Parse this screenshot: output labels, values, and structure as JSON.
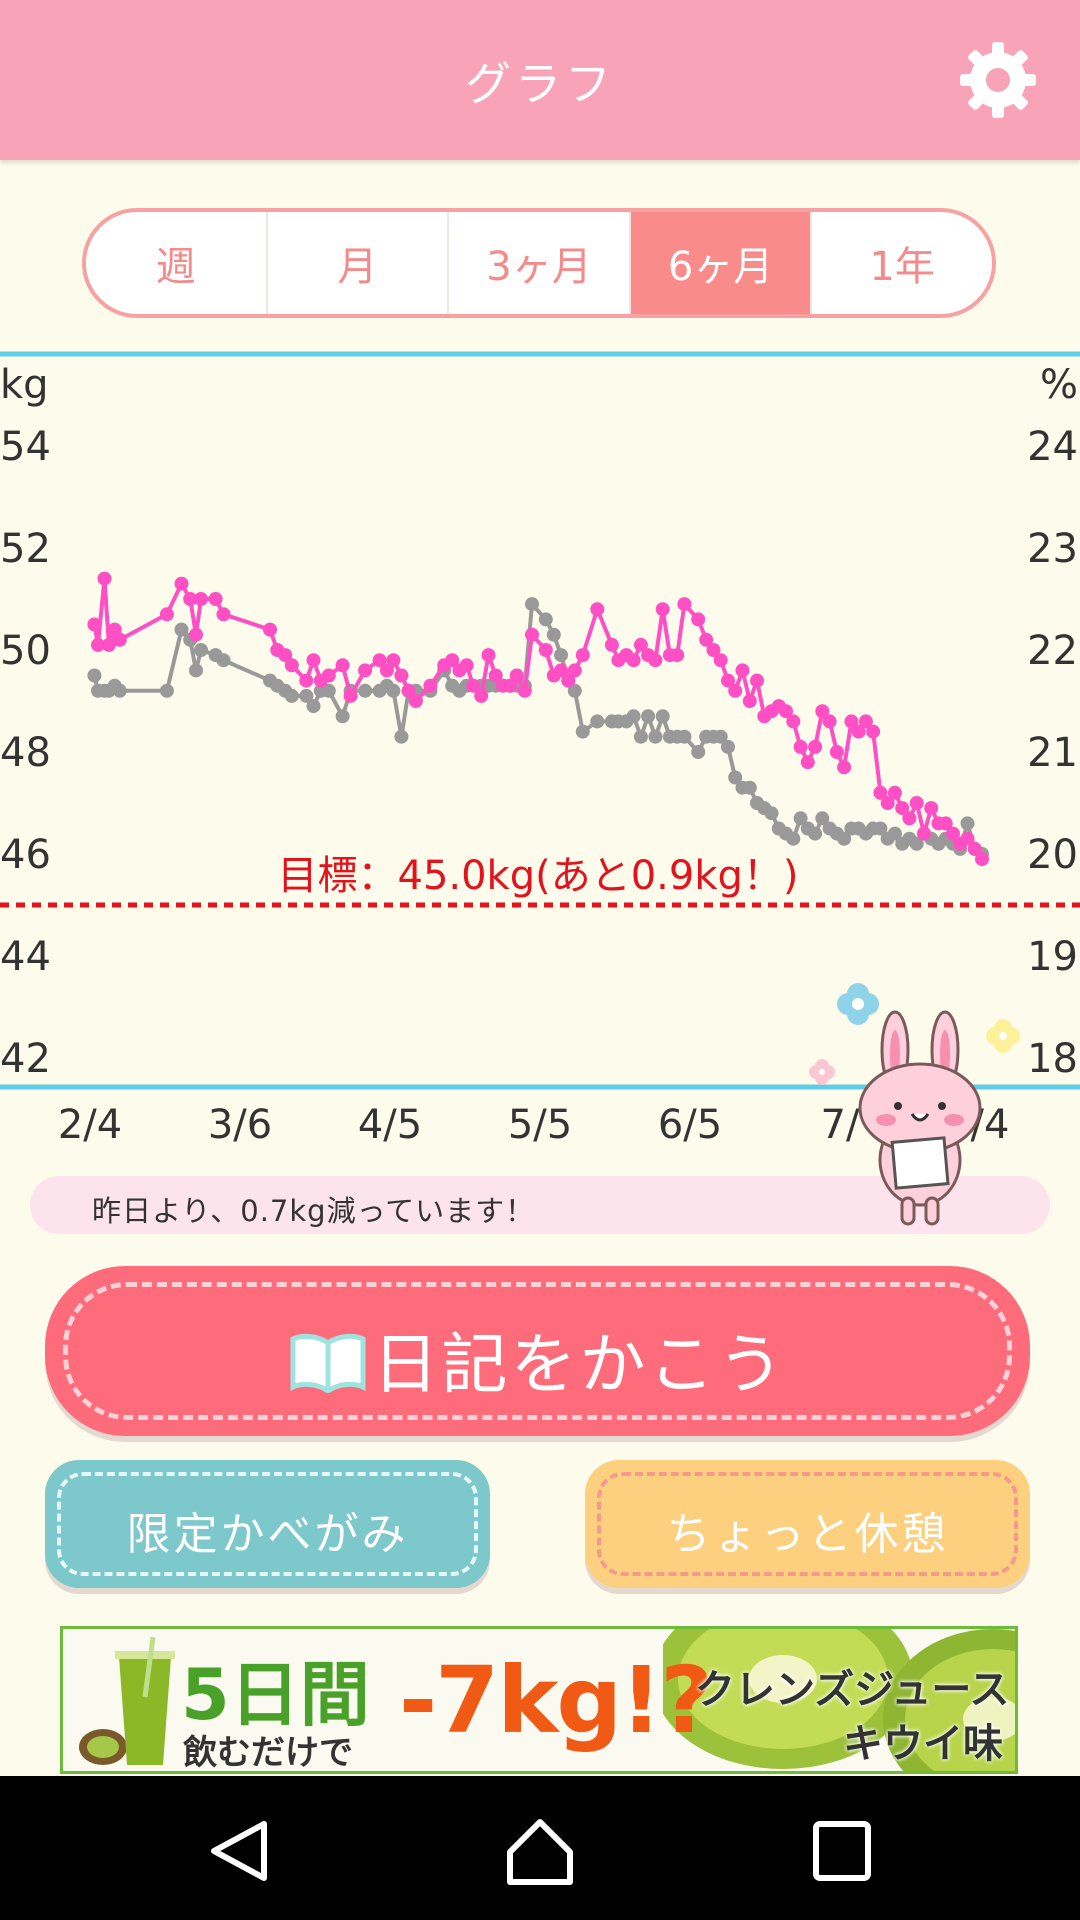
{
  "header": {
    "title": "グラフ",
    "settings_icon": "gear-icon"
  },
  "period_tabs": [
    {
      "label": "週",
      "active": false
    },
    {
      "label": "月",
      "active": false
    },
    {
      "label": "3ヶ月",
      "active": false
    },
    {
      "label": "6ヶ月",
      "active": true
    },
    {
      "label": "1年",
      "active": false
    }
  ],
  "chart_data": {
    "type": "line",
    "left_axis": {
      "unit": "kg",
      "ticks": [
        "54",
        "52",
        "50",
        "48",
        "46",
        "44",
        "42"
      ],
      "range": [
        42,
        54
      ]
    },
    "right_axis": {
      "unit": "%",
      "ticks": [
        "24",
        "23",
        "22",
        "21",
        "20",
        "19",
        "18"
      ],
      "range": [
        18,
        24
      ]
    },
    "x_ticks": [
      "2/4",
      "3/6",
      "4/5",
      "5/5",
      "6/5",
      "7/",
      "/4"
    ],
    "goal": {
      "value": 45.0,
      "label": "目標：45.0kg(あと0.9kg！)",
      "color": "#e1141e"
    },
    "series": [
      {
        "axis": "left",
        "color": "#ff4fc4",
        "points": [
          [
            0.6,
            50.5
          ],
          [
            1.1,
            50.1
          ],
          [
            2.0,
            51.4
          ],
          [
            2.6,
            50.1
          ],
          [
            3.4,
            50.4
          ],
          [
            4.1,
            50.2
          ],
          [
            10.6,
            50.7
          ],
          [
            12.6,
            51.3
          ],
          [
            13.8,
            51.0
          ],
          [
            14.6,
            50.3
          ],
          [
            15.3,
            51.0
          ],
          [
            17.3,
            51.0
          ],
          [
            18.4,
            50.7
          ],
          [
            24.8,
            50.4
          ],
          [
            25.8,
            50.0
          ],
          [
            26.9,
            49.9
          ],
          [
            27.8,
            49.7
          ],
          [
            29.8,
            49.4
          ],
          [
            30.8,
            49.8
          ],
          [
            31.8,
            49.4
          ],
          [
            32.9,
            49.5
          ],
          [
            34.8,
            49.7
          ],
          [
            35.9,
            49.1
          ],
          [
            37.9,
            49.6
          ],
          [
            39.9,
            49.8
          ],
          [
            40.9,
            49.6
          ],
          [
            41.8,
            49.8
          ],
          [
            42.9,
            49.5
          ],
          [
            43.9,
            49.2
          ],
          [
            44.9,
            49.0
          ],
          [
            46.9,
            49.3
          ],
          [
            48.8,
            49.7
          ],
          [
            49.9,
            49.8
          ],
          [
            50.9,
            49.6
          ],
          [
            51.9,
            49.7
          ],
          [
            52.8,
            49.3
          ],
          [
            53.9,
            49.1
          ],
          [
            54.9,
            49.9
          ],
          [
            55.9,
            49.5
          ],
          [
            56.9,
            49.3
          ],
          [
            57.9,
            49.3
          ],
          [
            58.8,
            49.5
          ],
          [
            59.9,
            49.2
          ],
          [
            60.9,
            50.3
          ],
          [
            62.8,
            50.0
          ],
          [
            63.9,
            49.5
          ],
          [
            64.9,
            49.6
          ],
          [
            65.9,
            49.4
          ],
          [
            66.8,
            49.6
          ],
          [
            67.9,
            49.9
          ],
          [
            69.9,
            50.8
          ],
          [
            71.9,
            50.1
          ],
          [
            72.8,
            49.8
          ],
          [
            73.9,
            49.9
          ],
          [
            74.9,
            49.8
          ],
          [
            75.9,
            50.1
          ],
          [
            76.9,
            49.9
          ],
          [
            77.9,
            49.8
          ],
          [
            78.9,
            50.8
          ],
          [
            79.9,
            49.9
          ],
          [
            80.9,
            49.9
          ],
          [
            81.9,
            50.9
          ],
          [
            83.8,
            50.6
          ],
          [
            84.9,
            50.2
          ],
          [
            85.9,
            50.0
          ],
          [
            86.9,
            49.8
          ],
          [
            87.9,
            49.4
          ],
          [
            88.9,
            49.2
          ],
          [
            89.9,
            49.6
          ],
          [
            90.9,
            49.0
          ],
          [
            91.9,
            49.4
          ],
          [
            92.9,
            48.7
          ],
          [
            93.9,
            48.8
          ],
          [
            94.9,
            48.9
          ],
          [
            95.9,
            48.8
          ],
          [
            96.9,
            48.6
          ],
          [
            97.9,
            48.1
          ],
          [
            98.9,
            47.8
          ],
          [
            99.9,
            48.1
          ],
          [
            100.9,
            48.8
          ],
          [
            101.9,
            48.6
          ],
          [
            102.9,
            48.0
          ],
          [
            103.9,
            47.7
          ],
          [
            104.9,
            48.6
          ],
          [
            105.9,
            48.4
          ],
          [
            106.9,
            48.6
          ],
          [
            107.9,
            48.4
          ],
          [
            108.9,
            47.2
          ],
          [
            109.9,
            47.0
          ],
          [
            110.9,
            47.2
          ],
          [
            111.9,
            46.9
          ],
          [
            112.9,
            46.7
          ],
          [
            113.9,
            47.0
          ],
          [
            114.9,
            46.4
          ],
          [
            115.9,
            46.9
          ],
          [
            116.9,
            46.6
          ],
          [
            117.9,
            46.6
          ],
          [
            118.9,
            46.4
          ],
          [
            119.9,
            46.2
          ],
          [
            120.9,
            46.3
          ],
          [
            121.9,
            46.1
          ],
          [
            122.9,
            45.9
          ]
        ]
      },
      {
        "axis": "left",
        "color": "#999999",
        "points": [
          [
            0.6,
            49.5
          ],
          [
            1.1,
            49.2
          ],
          [
            2.0,
            49.2
          ],
          [
            2.6,
            49.2
          ],
          [
            3.4,
            49.3
          ],
          [
            4.1,
            49.2
          ],
          [
            10.6,
            49.2
          ],
          [
            12.6,
            50.4
          ],
          [
            13.8,
            50.2
          ],
          [
            14.6,
            49.6
          ],
          [
            15.3,
            50.0
          ],
          [
            17.3,
            49.9
          ],
          [
            18.4,
            49.8
          ],
          [
            24.8,
            49.4
          ],
          [
            25.8,
            49.3
          ],
          [
            26.9,
            49.2
          ],
          [
            27.8,
            49.1
          ],
          [
            29.8,
            49.1
          ],
          [
            30.8,
            48.9
          ],
          [
            31.8,
            49.2
          ],
          [
            32.9,
            49.2
          ],
          [
            34.8,
            48.7
          ],
          [
            35.9,
            49.2
          ],
          [
            37.9,
            49.2
          ],
          [
            39.9,
            49.2
          ],
          [
            40.9,
            49.3
          ],
          [
            41.8,
            49.2
          ],
          [
            42.9,
            48.3
          ],
          [
            43.9,
            49.2
          ],
          [
            44.9,
            49.2
          ],
          [
            46.9,
            49.2
          ],
          [
            48.8,
            49.6
          ],
          [
            49.9,
            49.3
          ],
          [
            50.9,
            49.2
          ],
          [
            51.9,
            49.3
          ],
          [
            52.8,
            49.3
          ],
          [
            53.9,
            49.3
          ],
          [
            54.9,
            49.3
          ],
          [
            55.9,
            49.3
          ],
          [
            56.9,
            49.3
          ],
          [
            57.9,
            49.3
          ],
          [
            58.8,
            49.3
          ],
          [
            59.9,
            49.3
          ],
          [
            60.9,
            50.9
          ],
          [
            62.8,
            50.6
          ],
          [
            63.9,
            50.3
          ],
          [
            64.9,
            49.9
          ],
          [
            65.9,
            49.4
          ],
          [
            66.8,
            49.2
          ],
          [
            67.9,
            48.4
          ],
          [
            69.9,
            48.6
          ],
          [
            71.9,
            48.6
          ],
          [
            72.8,
            48.6
          ],
          [
            73.9,
            48.6
          ],
          [
            74.9,
            48.7
          ],
          [
            75.9,
            48.3
          ],
          [
            76.9,
            48.7
          ],
          [
            77.9,
            48.3
          ],
          [
            78.9,
            48.7
          ],
          [
            79.9,
            48.3
          ],
          [
            80.9,
            48.3
          ],
          [
            81.9,
            48.3
          ],
          [
            83.8,
            48.0
          ],
          [
            84.9,
            48.3
          ],
          [
            85.9,
            48.3
          ],
          [
            86.9,
            48.3
          ],
          [
            87.9,
            48.1
          ],
          [
            88.9,
            47.5
          ],
          [
            89.9,
            47.3
          ],
          [
            90.9,
            47.3
          ],
          [
            91.9,
            47.0
          ],
          [
            92.9,
            46.9
          ],
          [
            93.9,
            46.8
          ],
          [
            94.9,
            46.5
          ],
          [
            95.9,
            46.4
          ],
          [
            96.9,
            46.3
          ],
          [
            97.9,
            46.7
          ],
          [
            98.9,
            46.5
          ],
          [
            99.9,
            46.4
          ],
          [
            100.9,
            46.7
          ],
          [
            101.9,
            46.5
          ],
          [
            102.9,
            46.4
          ],
          [
            103.9,
            46.3
          ],
          [
            104.9,
            46.5
          ],
          [
            105.9,
            46.5
          ],
          [
            106.9,
            46.4
          ],
          [
            107.9,
            46.5
          ],
          [
            108.9,
            46.5
          ],
          [
            109.9,
            46.3
          ],
          [
            110.9,
            46.4
          ],
          [
            111.9,
            46.2
          ],
          [
            112.9,
            46.3
          ],
          [
            113.9,
            46.2
          ],
          [
            114.9,
            46.4
          ],
          [
            115.9,
            46.3
          ],
          [
            116.9,
            46.2
          ],
          [
            117.9,
            46.3
          ],
          [
            118.9,
            46.2
          ],
          [
            119.9,
            46.1
          ],
          [
            120.9,
            46.6
          ],
          [
            121.9,
            46.1
          ],
          [
            122.9,
            46.0
          ]
        ]
      }
    ]
  },
  "message": "昨日より、0.7kg減っています！",
  "buttons": {
    "diary": "日記をかこう",
    "wallpaper": "限定かべがみ",
    "break": "ちょっと休憩"
  },
  "ad": {
    "days": "5日間",
    "drink": "飲むだけで",
    "kg": "-7kg!?",
    "product": "クレンズジュース",
    "flavor": "キウイ味"
  },
  "nav": {
    "back": "back-icon",
    "home": "home-icon",
    "recents": "recents-icon"
  }
}
